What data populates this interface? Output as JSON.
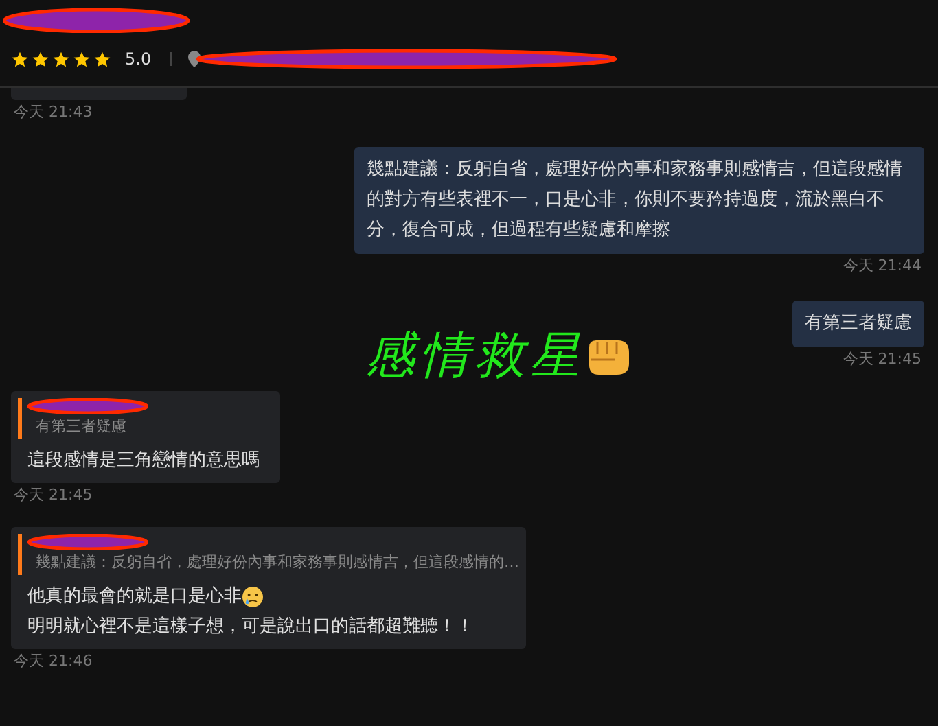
{
  "header": {
    "stars": 5,
    "rating": "5.0"
  },
  "messages": [
    {
      "kind": "partial",
      "time": "今天 21:43"
    },
    {
      "kind": "outgoing",
      "text": "幾點建議：反躬自省，處理好份內事和家務事則感情吉，但這段感情的對方有些表裡不一，口是心非，你則不要矜持過度，流於黑白不分，復合可成，但過程有些疑慮和摩擦",
      "time": "今天 21:44"
    },
    {
      "kind": "outgoing",
      "text": "有第三者疑慮",
      "time": "今天 21:45"
    },
    {
      "kind": "incoming",
      "quote": "有第三者疑慮",
      "lines": [
        "這段感情是三角戀情的意思嗎"
      ],
      "time": "今天 21:45"
    },
    {
      "kind": "incoming",
      "quote": "幾點建議：反躬自省，處理好份內事和家務事則感情吉，但這段感情的…",
      "lines": [
        "他真的最會的就是口是心非",
        "明明就心裡不是這樣子想，可是說出口的話都超難聽！！"
      ],
      "crying_emoji": true,
      "time": "今天 21:46"
    }
  ],
  "overlay": {
    "text": "感情救星"
  }
}
